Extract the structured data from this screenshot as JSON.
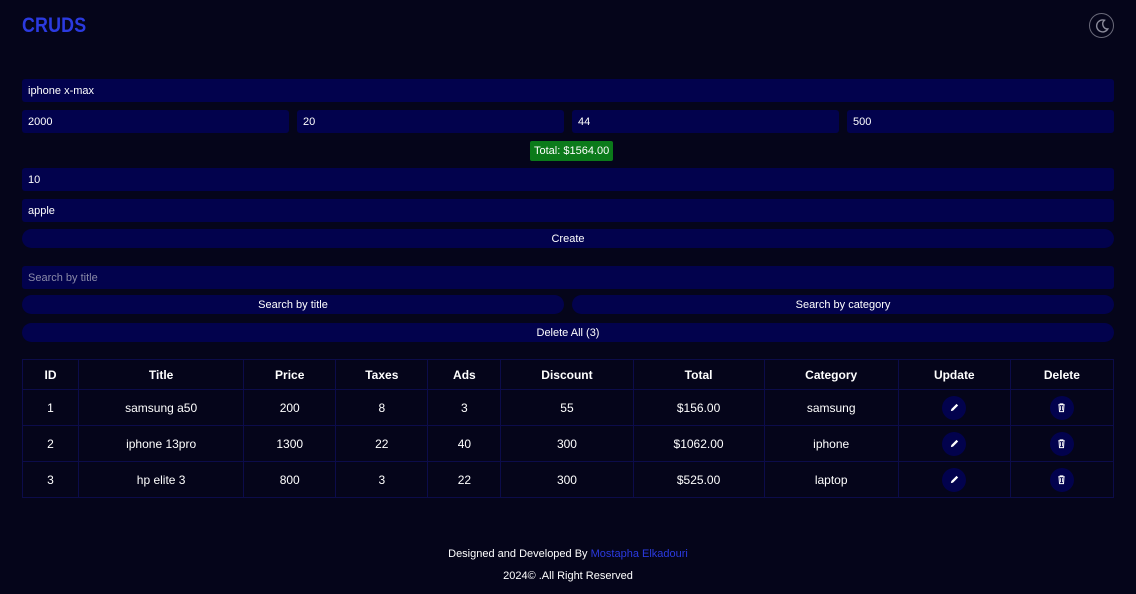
{
  "header": {
    "brand": "CRUDS",
    "theme_icon": "moon-icon"
  },
  "form": {
    "title": "iphone x-max",
    "price": "2000",
    "taxes": "20",
    "ads": "44",
    "discount": "500",
    "total_label": "Total: $1564.00",
    "count": "10",
    "category": "apple",
    "create_label": "Create"
  },
  "search": {
    "placeholder": "Search by title",
    "by_title_label": "Search by title",
    "by_category_label": "Search by category",
    "delete_all_label": "Delete All (3)"
  },
  "table": {
    "headers": [
      "ID",
      "Title",
      "Price",
      "Taxes",
      "Ads",
      "Discount",
      "Total",
      "Category",
      "Update",
      "Delete"
    ],
    "rows": [
      {
        "id": "1",
        "title": "samsung a50",
        "price": "200",
        "taxes": "8",
        "ads": "3",
        "discount": "55",
        "total": "$156.00",
        "category": "samsung"
      },
      {
        "id": "2",
        "title": "iphone 13pro",
        "price": "1300",
        "taxes": "22",
        "ads": "40",
        "discount": "300",
        "total": "$1062.00",
        "category": "iphone"
      },
      {
        "id": "3",
        "title": "hp elite 3",
        "price": "800",
        "taxes": "3",
        "ads": "22",
        "discount": "300",
        "total": "$525.00",
        "category": "laptop"
      }
    ],
    "update_icon": "pencil-icon",
    "delete_icon": "trash-icon"
  },
  "footer": {
    "designed_by": "Designed and Developed By",
    "author": "Mostapha Elkadouri",
    "copyright": "2024© .All Right Reserved"
  },
  "colors": {
    "background": "#05051a",
    "accent": "#2b3ae0",
    "field": "#02024d",
    "total_badge": "#0b7a1a"
  }
}
